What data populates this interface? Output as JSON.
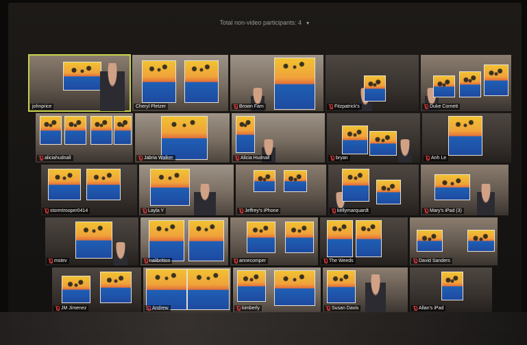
{
  "header": {
    "label": "Total non-video participants: 4",
    "caret": "▼"
  },
  "rows": [
    [
      {
        "name": "johnprice",
        "muted": false,
        "active": true
      },
      {
        "name": "Cheryl Pletzer",
        "muted": false
      },
      {
        "name": "Brown Fam",
        "muted": true
      },
      {
        "name": "Fitzpatrick's",
        "muted": true
      },
      {
        "name": "Duke Cornett",
        "muted": true
      }
    ],
    [
      {
        "name": "aliciahudnall",
        "muted": true
      },
      {
        "name": "Jabria Walker",
        "muted": true
      },
      {
        "name": "Alicia Hudnall",
        "muted": true
      },
      {
        "name": "bryan",
        "muted": true
      },
      {
        "name": "Anh Le",
        "muted": true
      }
    ],
    [
      {
        "name": "stormtrooper0414",
        "muted": true
      },
      {
        "name": "Layla Y",
        "muted": true
      },
      {
        "name": "Jeffrey's iPhone",
        "muted": true
      },
      {
        "name": "kellymarquardt",
        "muted": true
      },
      {
        "name": "Mary's iPad (3)",
        "muted": true
      }
    ],
    [
      {
        "name": "mstev",
        "muted": true
      },
      {
        "name": "nalibritton",
        "muted": true
      },
      {
        "name": "annecomper",
        "muted": true
      },
      {
        "name": "The Weeds",
        "muted": true
      },
      {
        "name": "David Sanders",
        "muted": true
      }
    ],
    [
      {
        "name": "JM Jimenez",
        "muted": true
      },
      {
        "name": "Andrew",
        "muted": true
      },
      {
        "name": "kimberly",
        "muted": true
      },
      {
        "name": "Susan Davis",
        "muted": true
      },
      {
        "name": "Allan's iPad",
        "muted": true
      }
    ]
  ]
}
